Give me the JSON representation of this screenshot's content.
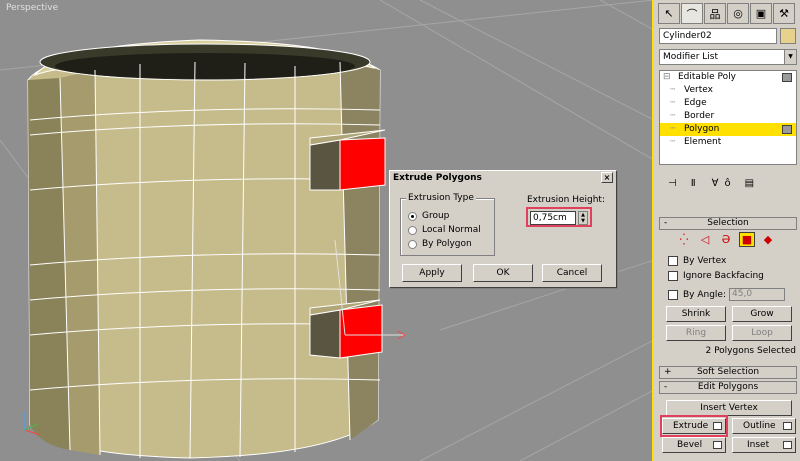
{
  "viewport": {
    "label": "Perspective"
  },
  "dialog": {
    "title": "Extrude Polygons",
    "close": "×",
    "extrusion_type_label": "Extrusion Type",
    "options": [
      "Group",
      "Local Normal",
      "By Polygon"
    ],
    "selected_option": "Group",
    "height_label": "Extrusion Height:",
    "height_value": "0,75cm",
    "buttons": {
      "apply": "Apply",
      "ok": "OK",
      "cancel": "Cancel"
    }
  },
  "panel": {
    "object_name": "Cylinder02",
    "modifier_list": "Modifier List",
    "stack": [
      {
        "label": "Editable Poly",
        "level": 0
      },
      {
        "label": "Vertex",
        "level": 1
      },
      {
        "label": "Edge",
        "level": 1
      },
      {
        "label": "Border",
        "level": 1
      },
      {
        "label": "Polygon",
        "level": 1,
        "selected": true
      },
      {
        "label": "Element",
        "level": 1
      }
    ],
    "selection": {
      "title": "Selection",
      "sign": "-",
      "by_vertex": "By Vertex",
      "ignore_backfacing": "Ignore Backfacing",
      "by_angle": "By Angle:",
      "angle_value": "45,0",
      "shrink": "Shrink",
      "grow": "Grow",
      "ring": "Ring",
      "loop": "Loop",
      "status": "2 Polygons Selected"
    },
    "soft_selection": {
      "title": "Soft Selection",
      "sign": "+"
    },
    "edit_polygons": {
      "title": "Edit Polygons",
      "sign": "-",
      "insert_vertex": "Insert Vertex",
      "extrude": "Extrude",
      "outline": "Outline",
      "bevel": "Bevel",
      "inset": "Inset"
    }
  },
  "colors": {
    "highlight": "#ffe000",
    "callout": "#e0405c",
    "selected_face": "#ff0000",
    "mesh": "#c8bd8c"
  }
}
